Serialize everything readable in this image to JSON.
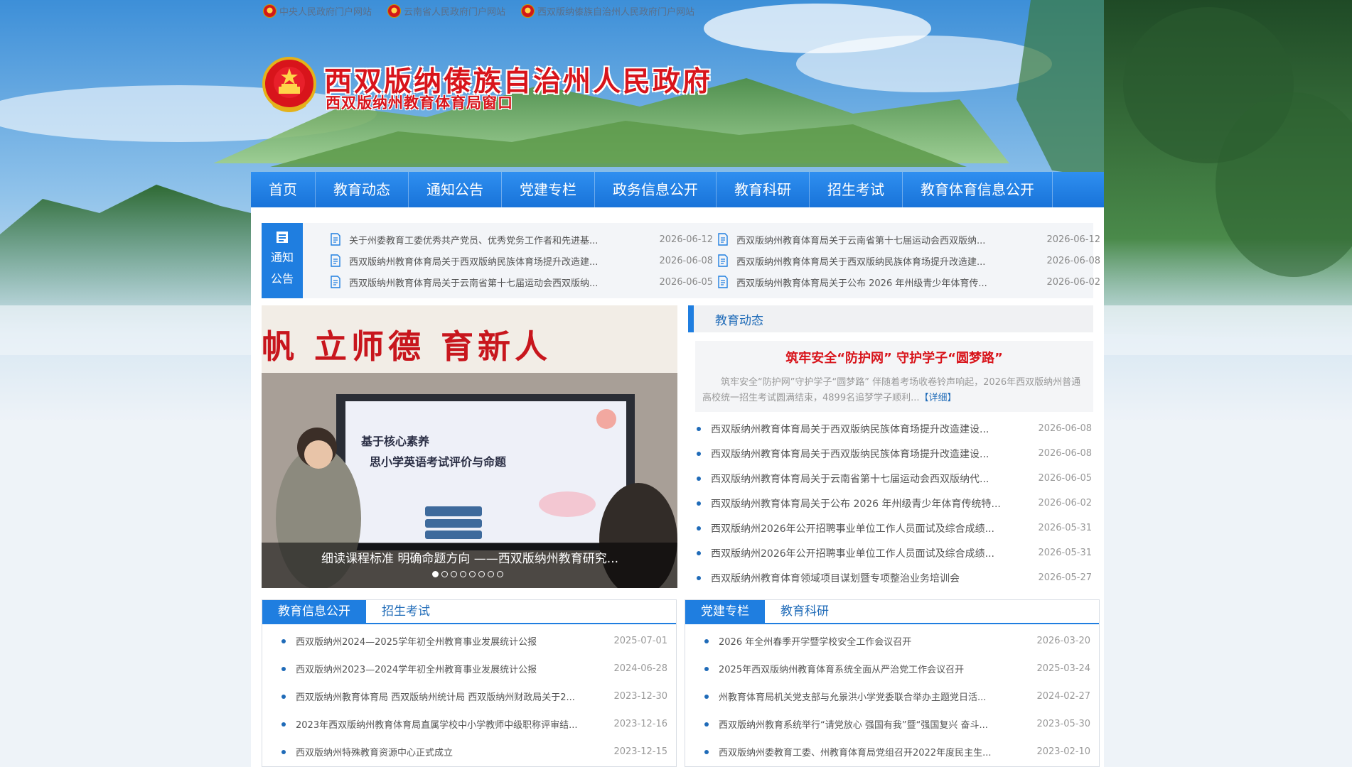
{
  "top_links": [
    {
      "label": "中央人民政府门户网站",
      "icon": "emblem-icon"
    },
    {
      "label": "云南省人民政府门户网站",
      "icon": "emblem-icon"
    },
    {
      "label": "西双版纳傣族自治州人民政府门户网站",
      "icon": "emblem-icon"
    }
  ],
  "header": {
    "title": "西双版纳傣族自治州人民政府",
    "subtitle": "西双版纳州教育体育局窗口",
    "emblem_color": "#d8141b"
  },
  "nav": {
    "items": [
      "首页",
      "教育动态",
      "通知公告",
      "党建专栏",
      "政务信息公开",
      "教育科研",
      "招生考试",
      "教育体育信息公开"
    ]
  },
  "notice": {
    "tag_label": "通知公告",
    "left": [
      {
        "title": "关于州委教育工委优秀共产党员、优秀党务工作者和先进基...",
        "date": "2026-06-12"
      },
      {
        "title": "西双版纳州教育体育局关于西双版纳民族体育场提升改造建...",
        "date": "2026-06-08"
      },
      {
        "title": "西双版纳州教育体育局关于云南省第十七届运动会西双版纳...",
        "date": "2026-06-05"
      }
    ],
    "right": [
      {
        "title": "西双版纳州教育体育局关于云南省第十七届运动会西双版纳...",
        "date": "2026-06-12"
      },
      {
        "title": "西双版纳州教育体育局关于西双版纳民族体育场提升改造建...",
        "date": "2026-06-08"
      },
      {
        "title": "西双版纳州教育体育局关于公布 2026 年州级青少年体育传...",
        "date": "2026-06-02"
      }
    ]
  },
  "slide": {
    "banner_text": "帆  立师德  育新人",
    "screen_line1": "基于核心素养",
    "screen_line2": "思小学英语考试评价与命题",
    "caption": "细读课程标准 明确命题方向 ——西双版纳州教育研究...",
    "dot_count": 8,
    "active_dot": 0
  },
  "news": {
    "header": "教育动态",
    "headline": "筑牢安全“防护网” 守护学子“圆梦路”",
    "summary": "筑牢安全“防护网”守护学子“圆梦路” 伴随着考场收卷铃声响起，2026年西双版纳州普通高校统一招生考试圆满结束，4899名追梦学子顺利...",
    "more": "【详细】",
    "items": [
      {
        "title": "西双版纳州教育体育局关于西双版纳民族体育场提升改造建设...",
        "date": "2026-06-08"
      },
      {
        "title": "西双版纳州教育体育局关于西双版纳民族体育场提升改造建设...",
        "date": "2026-06-08"
      },
      {
        "title": "西双版纳州教育体育局关于云南省第十七届运动会西双版纳代...",
        "date": "2026-06-05"
      },
      {
        "title": "西双版纳州教育体育局关于公布 2026 年州级青少年体育传统特...",
        "date": "2026-06-02"
      },
      {
        "title": "西双版纳州2026年公开招聘事业单位工作人员面试及综合成绩...",
        "date": "2026-05-31"
      },
      {
        "title": "西双版纳州2026年公开招聘事业单位工作人员面试及综合成绩...",
        "date": "2026-05-31"
      },
      {
        "title": "西双版纳州教育体育领域项目谋划暨专项整治业务培训会",
        "date": "2026-05-27"
      }
    ]
  },
  "panel_left": {
    "tabs": [
      "教育信息公开",
      "招生考试"
    ],
    "active_tab": 0,
    "items": [
      {
        "title": "西双版纳州2024—2025学年初全州教育事业发展统计公报",
        "date": "2025-07-01"
      },
      {
        "title": "西双版纳州2023—2024学年初全州教育事业发展统计公报",
        "date": "2024-06-28"
      },
      {
        "title": "西双版纳州教育体育局 西双版纳州统计局 西双版纳州财政局关于2...",
        "date": "2023-12-30"
      },
      {
        "title": "2023年西双版纳州教育体育局直属学校中小学教师中级职称评审结...",
        "date": "2023-12-16"
      },
      {
        "title": "西双版纳州特殊教育资源中心正式成立",
        "date": "2023-12-15"
      }
    ]
  },
  "panel_right": {
    "tabs": [
      "党建专栏",
      "教育科研"
    ],
    "active_tab": 0,
    "items": [
      {
        "title": "2026 年全州春季开学暨学校安全工作会议召开",
        "date": "2026-03-20"
      },
      {
        "title": "2025年西双版纳州教育体育系统全面从严治党工作会议召开",
        "date": "2025-03-24"
      },
      {
        "title": "州教育体育局机关党支部与允景洪小学党委联合举办主题党日活...",
        "date": "2024-02-27"
      },
      {
        "title": "西双版纳州教育系统举行“请党放心 强国有我”暨“强国复兴 奋斗...",
        "date": "2023-05-30"
      },
      {
        "title": "西双版纳州委教育工委、州教育体育局党组召开2022年度民主生...",
        "date": "2023-02-10"
      }
    ]
  },
  "colors": {
    "accent": "#1f7ee0",
    "title_red": "#d8141b",
    "link_blue": "#1f6bb8"
  }
}
